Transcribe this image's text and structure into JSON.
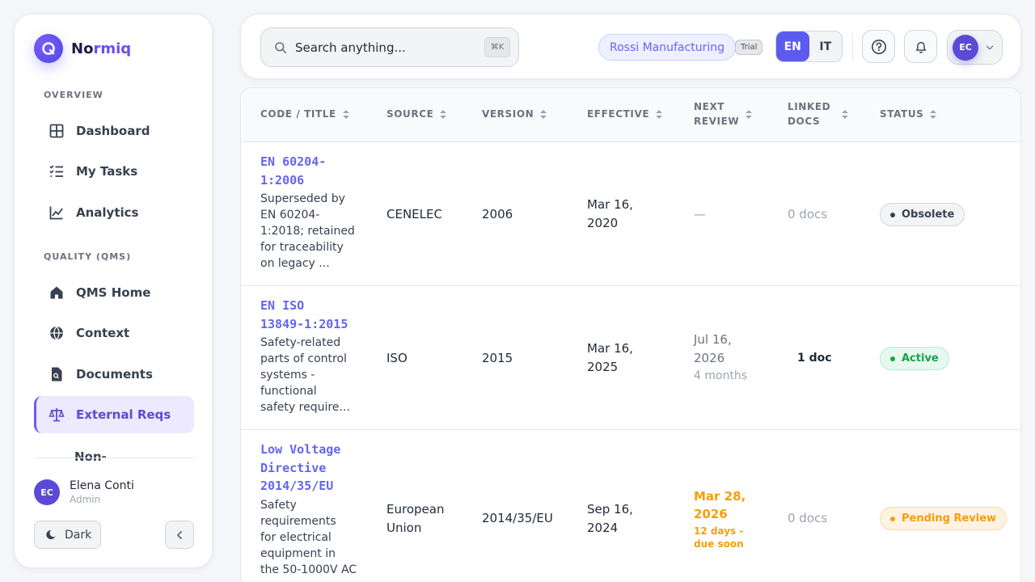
{
  "brand": {
    "prefix": "No",
    "accent": "rmiq",
    "logo_letter": "Q"
  },
  "sidebar": {
    "sections": [
      {
        "title": "OVERVIEW"
      },
      {
        "title": "QUALITY (QMS)"
      }
    ],
    "items": [
      {
        "label": "Dashboard",
        "icon": "grid-icon"
      },
      {
        "label": "My Tasks",
        "icon": "checklist-icon"
      },
      {
        "label": "Analytics",
        "icon": "chart-line-icon"
      },
      {
        "label": "QMS Home",
        "icon": "home-icon"
      },
      {
        "label": "Context",
        "icon": "globe-icon"
      },
      {
        "label": "Documents",
        "icon": "file-icon"
      },
      {
        "label": "External Reqs",
        "icon": "scale-icon",
        "active": true
      },
      {
        "label": "Non-",
        "icon": "none"
      }
    ],
    "user": {
      "initials": "EC",
      "name": "Elena Conti",
      "role": "Admin"
    },
    "dark_label": "Dark"
  },
  "topbar": {
    "search_placeholder": "Search anything...",
    "shortcut": "⌘K",
    "org": "Rossi Manufacturing",
    "plan": "Trial",
    "languages": [
      "EN",
      "IT"
    ],
    "active_language": "EN",
    "avatar_initials": "EC"
  },
  "table": {
    "columns": [
      "CODE / TITLE",
      "SOURCE",
      "VERSION",
      "EFFECTIVE",
      "NEXT REVIEW",
      "LINKED DOCS",
      "STATUS"
    ],
    "column_lines": [
      [
        "CODE / TITLE"
      ],
      [
        "SOURCE"
      ],
      [
        "VERSION"
      ],
      [
        "EFFECTIVE"
      ],
      [
        "NEXT",
        "REVIEW"
      ],
      [
        "LINKED",
        "DOCS"
      ],
      [
        "STATUS"
      ]
    ],
    "rows": [
      {
        "code_lines": [
          "EN 60204-",
          "1:2006"
        ],
        "desc_lines": [
          "Superseded by",
          "EN 60204-",
          "1:2018; retained",
          "for traceability",
          "on legacy ..."
        ],
        "source_lines": [
          "CENELEC"
        ],
        "version": "2006",
        "effective_lines": [
          "Mar 16,",
          "2020"
        ],
        "next_review": "—",
        "next_review_sub": "",
        "linked": "0 docs",
        "status": "Obsolete"
      },
      {
        "code_lines": [
          "EN ISO",
          "13849-1:2015"
        ],
        "desc_lines": [
          "Safety-related",
          "parts of control",
          "systems -",
          "functional",
          "safety require..."
        ],
        "source_lines": [
          "ISO"
        ],
        "version": "2015",
        "effective_lines": [
          "Mar 16,",
          "2025"
        ],
        "next_review_lines": [
          "Jul 16,",
          "2026"
        ],
        "next_review_sub": "4 months",
        "linked": "1 doc",
        "status": "Active"
      },
      {
        "code_lines": [
          "Low Voltage",
          "Directive",
          "2014/35/EU"
        ],
        "desc_lines": [
          "Safety",
          "requirements",
          "for electrical",
          "equipment in",
          "the 50-1000V AC"
        ],
        "source_lines": [
          "European",
          "Union"
        ],
        "version": "2014/35/EU",
        "effective_lines": [
          "Sep 16,",
          "2024"
        ],
        "next_review_lines": [
          "Mar 28,",
          "2026"
        ],
        "next_review_sub_lines": [
          "12 days -",
          "due soon"
        ],
        "linked": "0 docs",
        "status": "Pending Review"
      }
    ]
  },
  "colors": {
    "accent": "#6366f1",
    "active": "#16a34a",
    "pending": "#f59e0b"
  }
}
